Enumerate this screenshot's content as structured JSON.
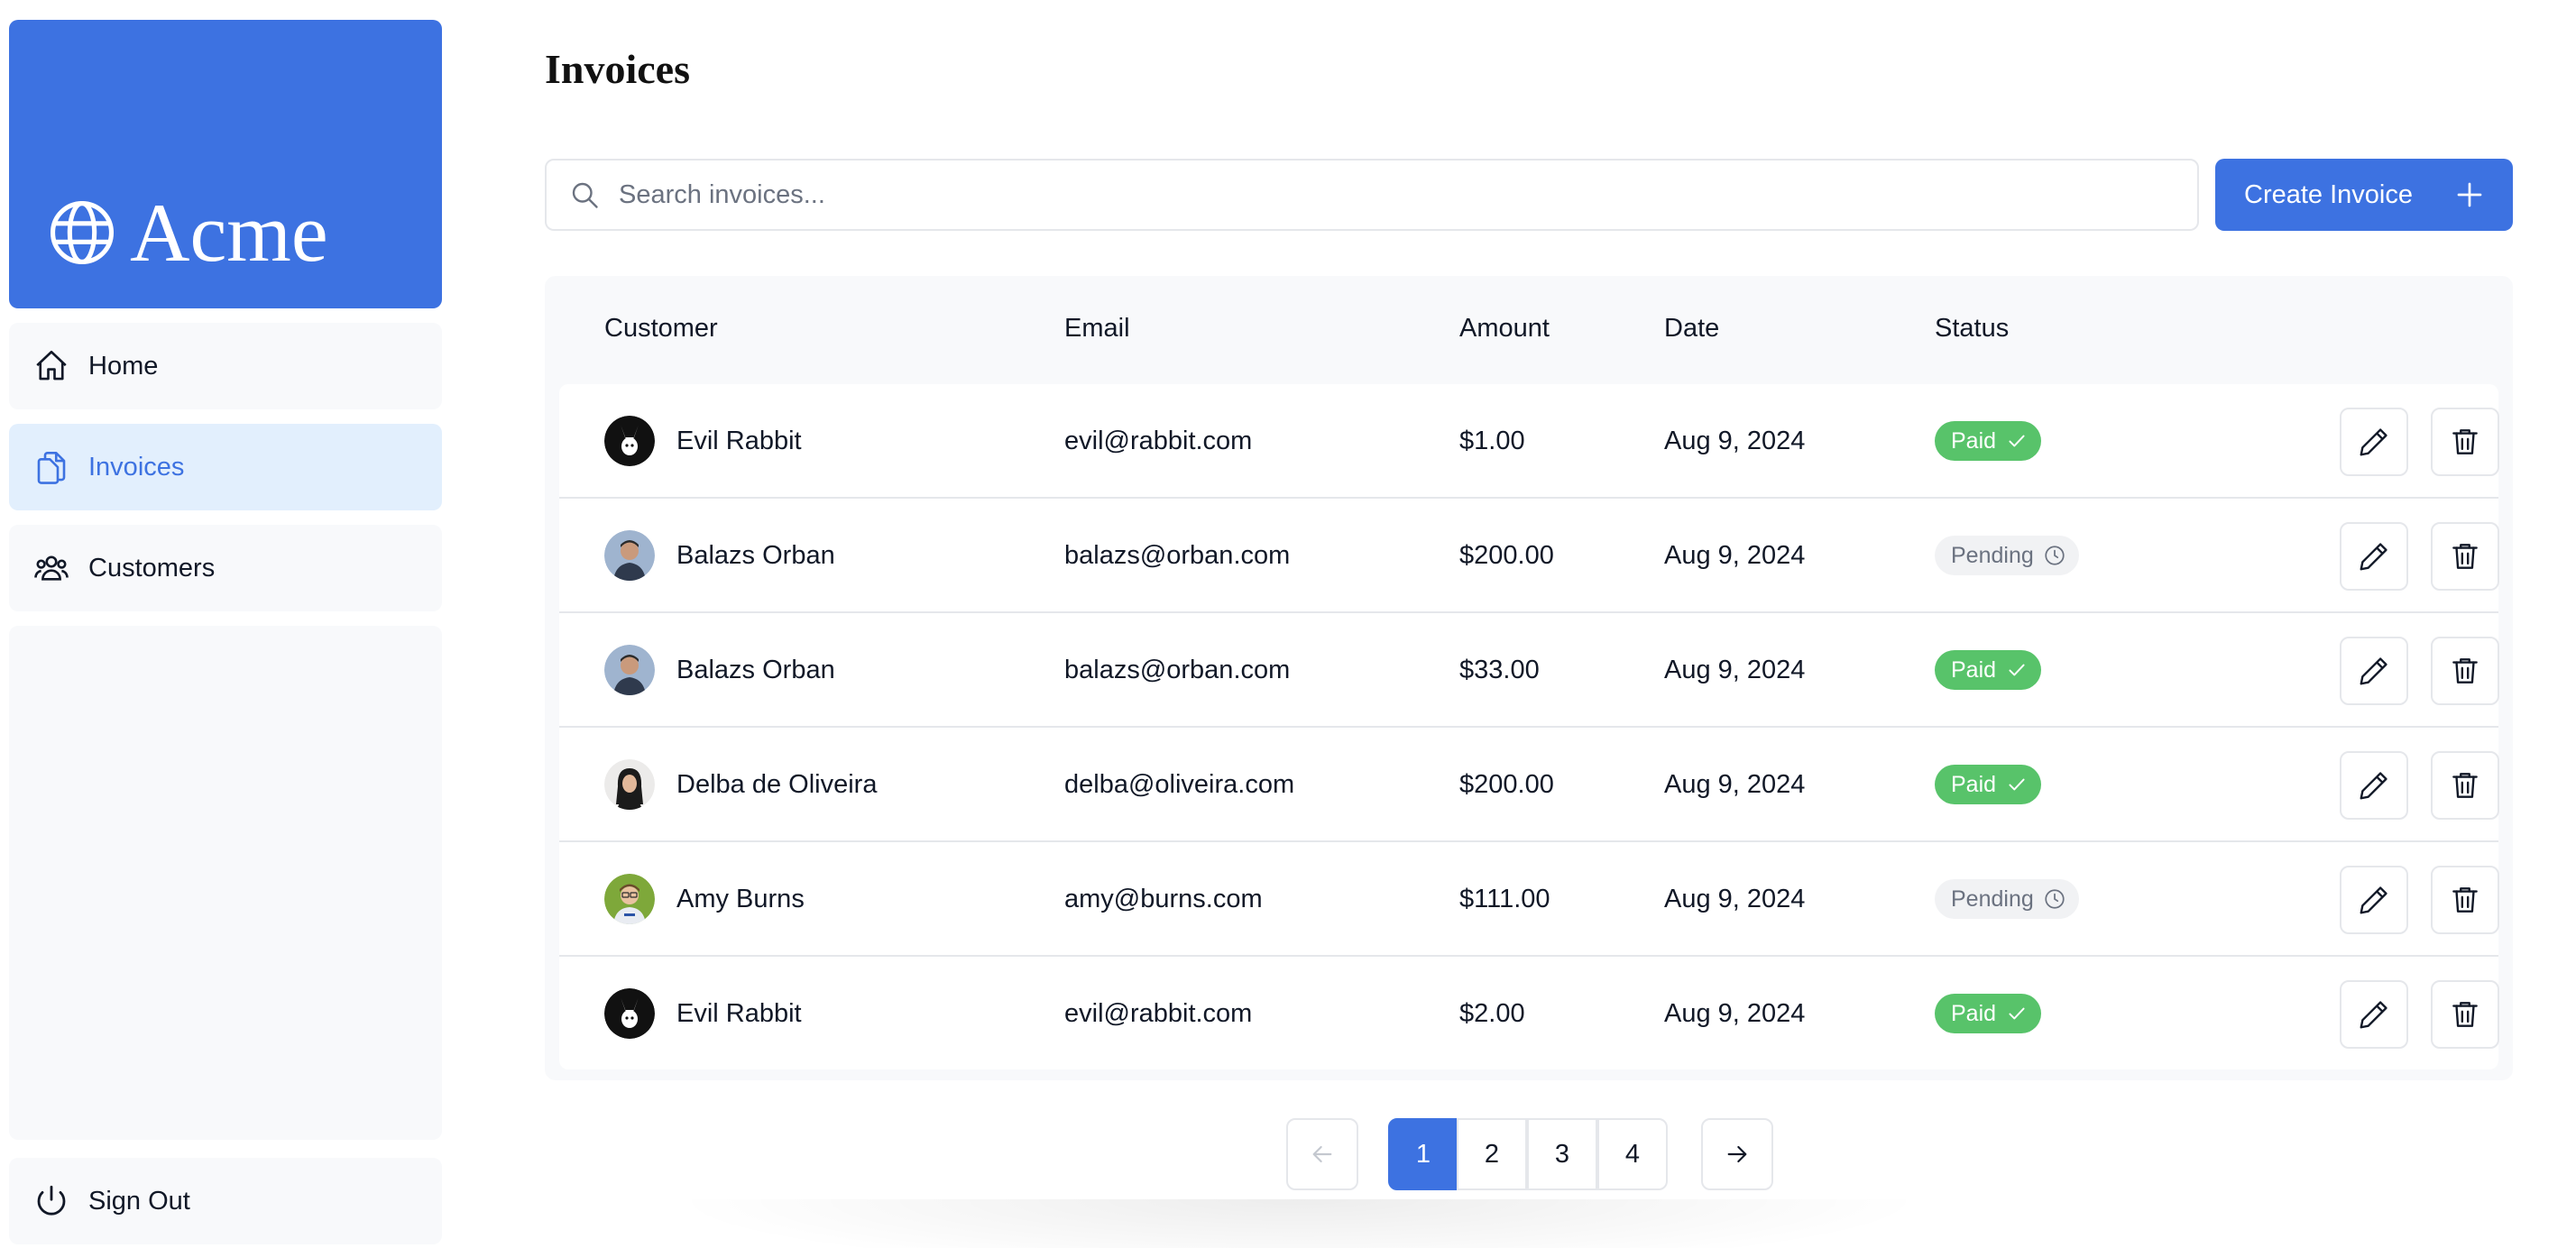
{
  "brand": {
    "name": "Acme",
    "accent": "#3d72e1"
  },
  "sidebar": {
    "items": [
      {
        "label": "Home",
        "icon": "home-icon"
      },
      {
        "label": "Invoices",
        "icon": "document-duplicate-icon",
        "active": true
      },
      {
        "label": "Customers",
        "icon": "users-icon"
      }
    ],
    "signout": {
      "label": "Sign Out",
      "icon": "power-icon"
    }
  },
  "page": {
    "title": "Invoices"
  },
  "search": {
    "placeholder": "Search invoices..."
  },
  "create_button": {
    "label": "Create Invoice"
  },
  "table": {
    "headers": [
      "Customer",
      "Email",
      "Amount",
      "Date",
      "Status"
    ],
    "rows": [
      {
        "name": "Evil Rabbit",
        "email": "evil@rabbit.com",
        "amount": "$1.00",
        "date": "Aug 9, 2024",
        "status": "Paid",
        "avatar": "rabbit"
      },
      {
        "name": "Balazs Orban",
        "email": "balazs@orban.com",
        "amount": "$200.00",
        "date": "Aug 9, 2024",
        "status": "Pending",
        "avatar": "balazs"
      },
      {
        "name": "Balazs Orban",
        "email": "balazs@orban.com",
        "amount": "$33.00",
        "date": "Aug 9, 2024",
        "status": "Paid",
        "avatar": "balazs"
      },
      {
        "name": "Delba de Oliveira",
        "email": "delba@oliveira.com",
        "amount": "$200.00",
        "date": "Aug 9, 2024",
        "status": "Paid",
        "avatar": "delba"
      },
      {
        "name": "Amy Burns",
        "email": "amy@burns.com",
        "amount": "$111.00",
        "date": "Aug 9, 2024",
        "status": "Pending",
        "avatar": "amy"
      },
      {
        "name": "Evil Rabbit",
        "email": "evil@rabbit.com",
        "amount": "$2.00",
        "date": "Aug 9, 2024",
        "status": "Paid",
        "avatar": "rabbit"
      }
    ]
  },
  "pagination": {
    "pages": [
      "1",
      "2",
      "3",
      "4"
    ],
    "current": "1"
  },
  "colors": {
    "paid": "#58c36a",
    "pending_bg": "#f1f2f4",
    "active_nav_bg": "#e2effd"
  }
}
